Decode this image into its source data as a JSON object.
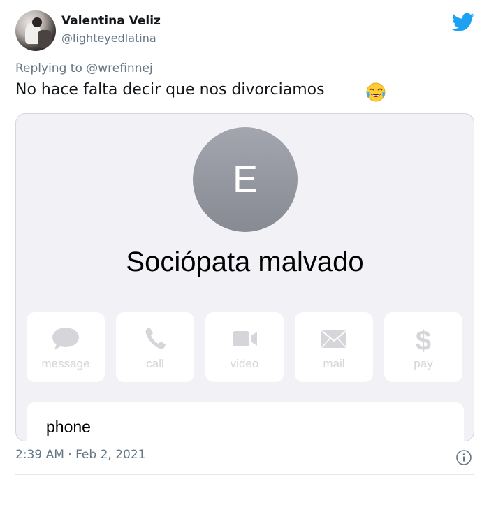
{
  "tweet": {
    "display_name": "Valentina Veliz",
    "handle": "@lighteyedlatina",
    "replying_to": "Replying to @wrefinnej",
    "text": "No hace falta decir que nos divorciamos",
    "emoji_icon": "face-with-tears-of-joy-icon",
    "timestamp": "2:39 AM · Feb 2, 2021",
    "brand_color": "#1da1f2"
  },
  "screenshot": {
    "contact_initial": "E",
    "contact_name": "Sociópata malvado",
    "actions": [
      {
        "label": "message",
        "icon": "message-bubble-icon"
      },
      {
        "label": "call",
        "icon": "phone-icon"
      },
      {
        "label": "video",
        "icon": "video-camera-icon"
      },
      {
        "label": "mail",
        "icon": "envelope-icon"
      },
      {
        "label": "pay",
        "icon": "dollar-sign-icon"
      }
    ],
    "phone_label": "phone"
  }
}
